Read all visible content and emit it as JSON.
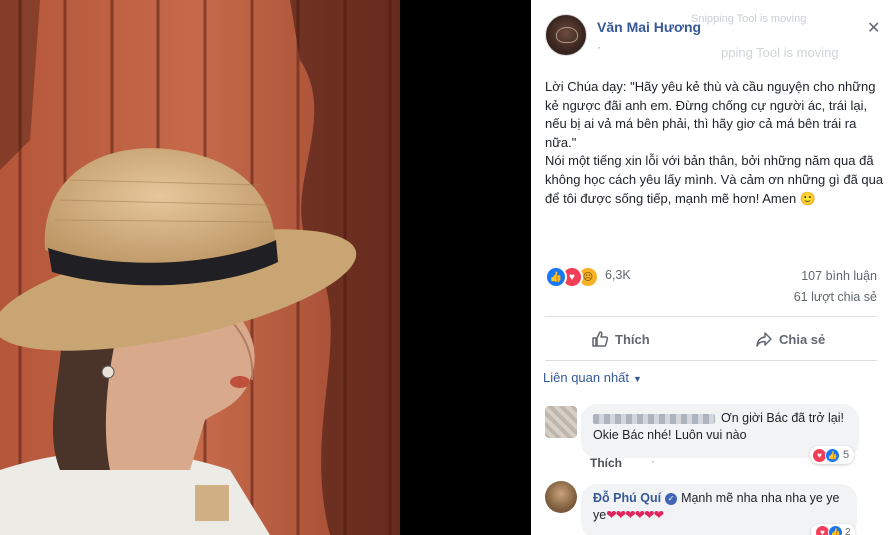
{
  "post": {
    "author": "Văn Mai Hương",
    "meta": "·",
    "close_icon": "✕",
    "ghost_overlay_1": "Snipping Tool is moving",
    "ghost_overlay_2": "pping Tool is moving",
    "body_line_1": "Lời Chúa dạy: \"Hãy yêu kẻ thù và cầu nguyện cho những kẻ ngược đãi anh em. Đừng chống cự người ác, trái lại, nếu bị ai vả má bên phải, thì hãy giơ cả má bên trái ra nữa.\"",
    "body_line_2": "Nói một tiếng xin lỗi với bản thân, bởi những năm qua đã không học cách yêu lấy mình. Và cảm ơn những gì đã qua để tôi được sống tiếp, mạnh mẽ hơn! Amen 🙂"
  },
  "stats": {
    "reaction_icons": [
      "like-icon",
      "love-icon",
      "sad-icon"
    ],
    "reaction_count": "6,3K",
    "comments": "107 bình luận",
    "shares": "61 lượt chia sẻ"
  },
  "actions": {
    "like_label": "Thích",
    "share_label": "Chia sẻ"
  },
  "comments_section": {
    "sort_label": "Liên quan nhất",
    "comments": [
      {
        "name": "",
        "text_line_1": "Ơn giời Bác đã trở lại!",
        "text_line_2": "Okie Bác nhé! Luôn vui nào",
        "like_label": "Thích",
        "dot": "·",
        "reaction_count": "5"
      },
      {
        "name": "Đỗ Phú Quí",
        "text": "Mạnh mẽ nha nha nha ye ye ye",
        "emoji": "❤❤❤❤❤❤",
        "reaction_count": "2"
      }
    ]
  },
  "colors": {
    "link_blue": "#365899",
    "like_blue": "#1877f2",
    "love_red": "#f33e58",
    "sad_yellow": "#f7b125"
  }
}
